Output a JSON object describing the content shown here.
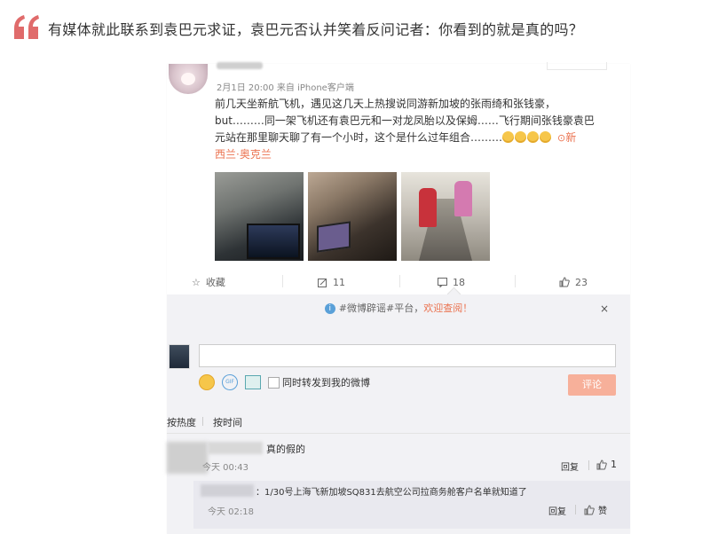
{
  "headline": "有媒体就此联系到袁巴元求证，袁巴元否认并笑着反问记者：你看到的就是真的吗？",
  "post": {
    "meta": "2月1日 20:00 来自 iPhone客户端",
    "text_lines": [
      "前几天坐新航飞机，遇见这几天上热搜说同游新加坡的张雨绮和张钱豪，",
      "but………同一架飞机还有袁巴元和一对龙凤胎以及保姆……飞行期间张钱豪袁巴",
      "元站在那里聊天聊了有一个小时，这个是什么过年组合………"
    ],
    "location_line1": "新",
    "location_line2": "西兰·奥克兰",
    "emoji_count": 4,
    "colors": {
      "accent": "#eb7350"
    }
  },
  "actions": {
    "favorite_label": "收藏",
    "repost_count": "11",
    "comment_count": "18",
    "like_count": "23"
  },
  "comments_panel": {
    "notice_text": "#微博辟谣#平台，",
    "notice_link": "欢迎查阅！",
    "close_label": "×",
    "repost_label": "同时转发到我的微博",
    "submit_label": "评论",
    "sort_hot": "按热度",
    "sort_time": "按时间",
    "comments": [
      {
        "text": "真的假的",
        "time": "今天 00:43",
        "reply_label": "回复",
        "likes": "1"
      },
      {
        "text": "：1/30号上海飞新加坡SQ831去航空公司拉商务舱客户名单就知道了",
        "time": "今天 02:18",
        "reply_label": "回复",
        "likes": "赞"
      }
    ]
  }
}
